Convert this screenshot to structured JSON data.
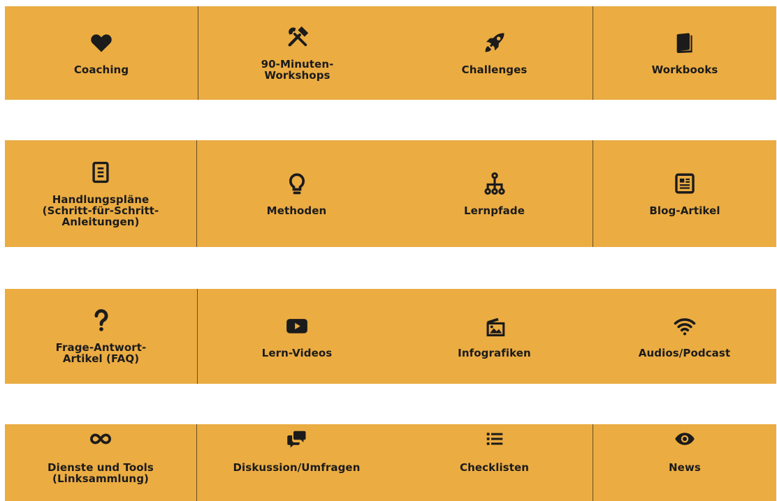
{
  "colors": {
    "tile_background": "#ebac42",
    "text": "#1b1b1b",
    "divider": "#3a2f1a"
  },
  "rows": [
    [
      {
        "label": "Coaching",
        "icon": "heart-icon"
      },
      {
        "label": "90-Minuten-\nWorkshops",
        "icon": "tools-icon"
      },
      {
        "label": "Challenges",
        "icon": "rocket-icon"
      },
      {
        "label": "Workbooks",
        "icon": "book-icon"
      }
    ],
    [
      {
        "label": "Handlungspläne\n(Schritt-für-Schritt-\nAnleitungen)",
        "icon": "document-icon"
      },
      {
        "label": "Methoden",
        "icon": "lightbulb-icon"
      },
      {
        "label": "Lernpfade",
        "icon": "sitemap-icon"
      },
      {
        "label": "Blog-Artikel",
        "icon": "newspaper-icon"
      }
    ],
    [
      {
        "label": "Frage-Antwort-\nArtikel (FAQ)",
        "icon": "question-icon"
      },
      {
        "label": "Lern-Videos",
        "icon": "video-play-icon"
      },
      {
        "label": "Infografiken",
        "icon": "images-icon"
      },
      {
        "label": "Audios/Podcast",
        "icon": "wifi-icon"
      }
    ],
    [
      {
        "label": "Dienste und Tools\n(Linksammlung)",
        "icon": "infinity-icon"
      },
      {
        "label": "Diskussion/Umfragen",
        "icon": "comments-icon"
      },
      {
        "label": "Checklisten",
        "icon": "list-icon"
      },
      {
        "label": "News",
        "icon": "eye-icon"
      }
    ]
  ]
}
